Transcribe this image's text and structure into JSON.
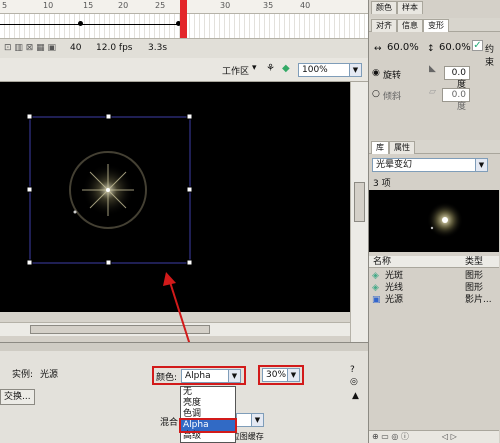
{
  "timeline": {
    "ruler_labels": [
      "5",
      "10",
      "15",
      "20",
      "25",
      "30",
      "35",
      "40"
    ],
    "frame": "40",
    "fps": "12.0 fps",
    "time": "3.3s"
  },
  "editbar": {
    "workspace_label": "工作区",
    "zoom_value": "100%"
  },
  "properties": {
    "instance_label": "实例:",
    "instance_name": "光源",
    "swap_button": "交换...",
    "color_label": "颜色:",
    "color_value": "Alpha",
    "alpha_value": "30%",
    "blend_label": "混合",
    "runtime_cache_label": "使用运行时位图缓存",
    "color_options": [
      "无",
      "亮度",
      "色调",
      "Alpha",
      "高级"
    ],
    "selected_option": "Alpha"
  },
  "transform_panel": {
    "top_tabs": [
      "颜色",
      "样本"
    ],
    "tabs": [
      "对齐",
      "信息",
      "变形"
    ],
    "width_pct": "60.0%",
    "height_pct": "60.0%",
    "constrain_label": "约束",
    "rotate_label": "旋转",
    "rotate_value": "0.0度",
    "skew_label": "倾斜",
    "skew_value": "0.0度"
  },
  "library": {
    "tab_label": "库",
    "tab2_label": "属性",
    "doc_name": "光晕变幻",
    "item_count": "3 项",
    "col_name": "名称",
    "col_type": "类型",
    "items": [
      {
        "name": "光斑",
        "type": "图形"
      },
      {
        "name": "光线",
        "type": "图形"
      },
      {
        "name": "光源",
        "type": "影片..."
      }
    ]
  },
  "colors": {
    "annotation_red": "#d21a1a",
    "selection_blue": "#316ac5",
    "stage_bg": "#000000"
  }
}
